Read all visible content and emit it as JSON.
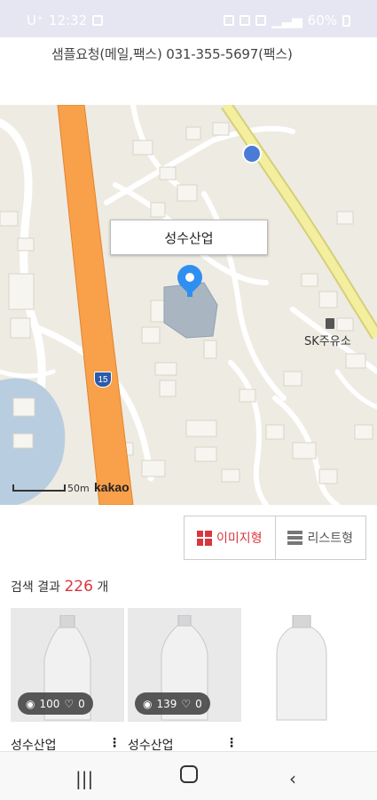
{
  "status_bar": {
    "carrier": "U⁺",
    "time": "12:32",
    "battery": "60%"
  },
  "header": {
    "contact": "샘플요청(메일,팩스)  031-355-5697(팩스)"
  },
  "map": {
    "marker_label": "성수산업",
    "highway_number": "15",
    "poi_label": "SK주유소",
    "scale_label": "50m",
    "provider": "kakao"
  },
  "view_toggle": {
    "image_label": "이미지형",
    "list_label": "리스트형",
    "active": "image"
  },
  "results": {
    "prefix": "검색 결과",
    "count": "226",
    "suffix": "개"
  },
  "products": [
    {
      "name": "성수산업",
      "views": "100",
      "likes": "0"
    },
    {
      "name": "성수산업",
      "views": "139",
      "likes": "0"
    },
    {
      "name": "",
      "views": "",
      "likes": ""
    }
  ],
  "colors": {
    "accent": "#d9363e",
    "highway": "#f9a04a",
    "road_yellow": "#f4ef9f",
    "marker": "#2f8ff0"
  },
  "icons": [
    "bus-stop-icon",
    "location-pin-icon",
    "gas-station-icon",
    "highway-shield-icon",
    "eye-icon",
    "heart-icon",
    "grid-icon",
    "list-icon",
    "recent-apps-icon",
    "home-icon",
    "back-icon"
  ]
}
